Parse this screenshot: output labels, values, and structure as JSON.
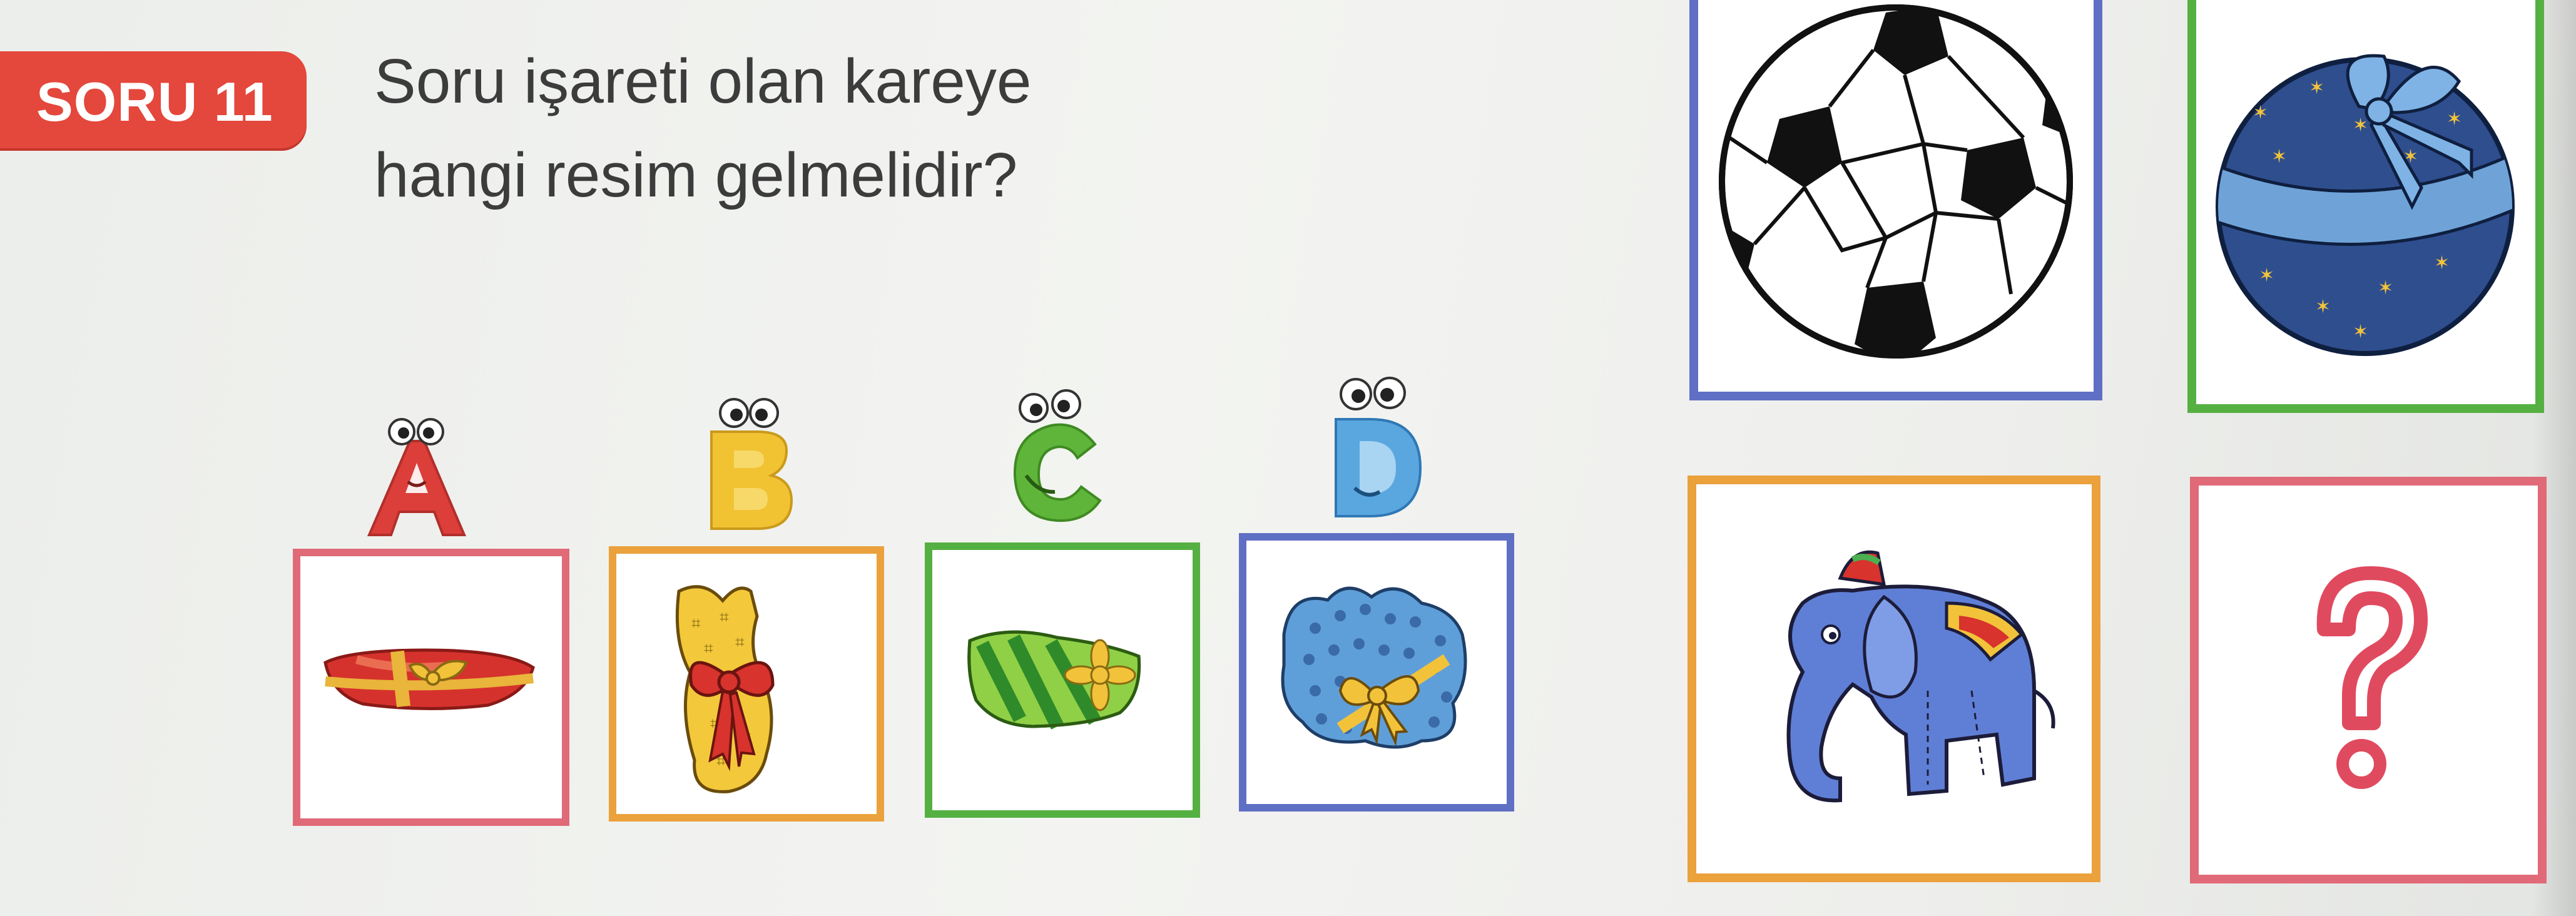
{
  "badge": {
    "label": "SORU 11"
  },
  "question": {
    "line1": "Soru işareti olan kareye",
    "line2": "hangi resim gelmelidir?"
  },
  "options": [
    {
      "letter": "A",
      "color": "#dc3e3a",
      "item": "red-gift-icon",
      "frame": "#e06a78"
    },
    {
      "letter": "B",
      "color": "#f1c232",
      "item": "yellow-gift-icon",
      "frame": "#eba13c"
    },
    {
      "letter": "C",
      "color": "#5fb53a",
      "item": "green-gift-icon",
      "frame": "#55b042"
    },
    {
      "letter": "D",
      "color": "#5aa7e0",
      "item": "blue-gift-icon",
      "frame": "#5f6fc4"
    }
  ],
  "sequence": [
    {
      "item": "soccer-ball-icon",
      "frame": "#5f6fc4"
    },
    {
      "item": "blue-ball-gift-icon",
      "frame": "#55b042"
    },
    {
      "item": "elephant-toy-icon",
      "frame": "#eba13c"
    },
    {
      "item": "question-mark-icon",
      "frame": "#e06a78"
    }
  ]
}
